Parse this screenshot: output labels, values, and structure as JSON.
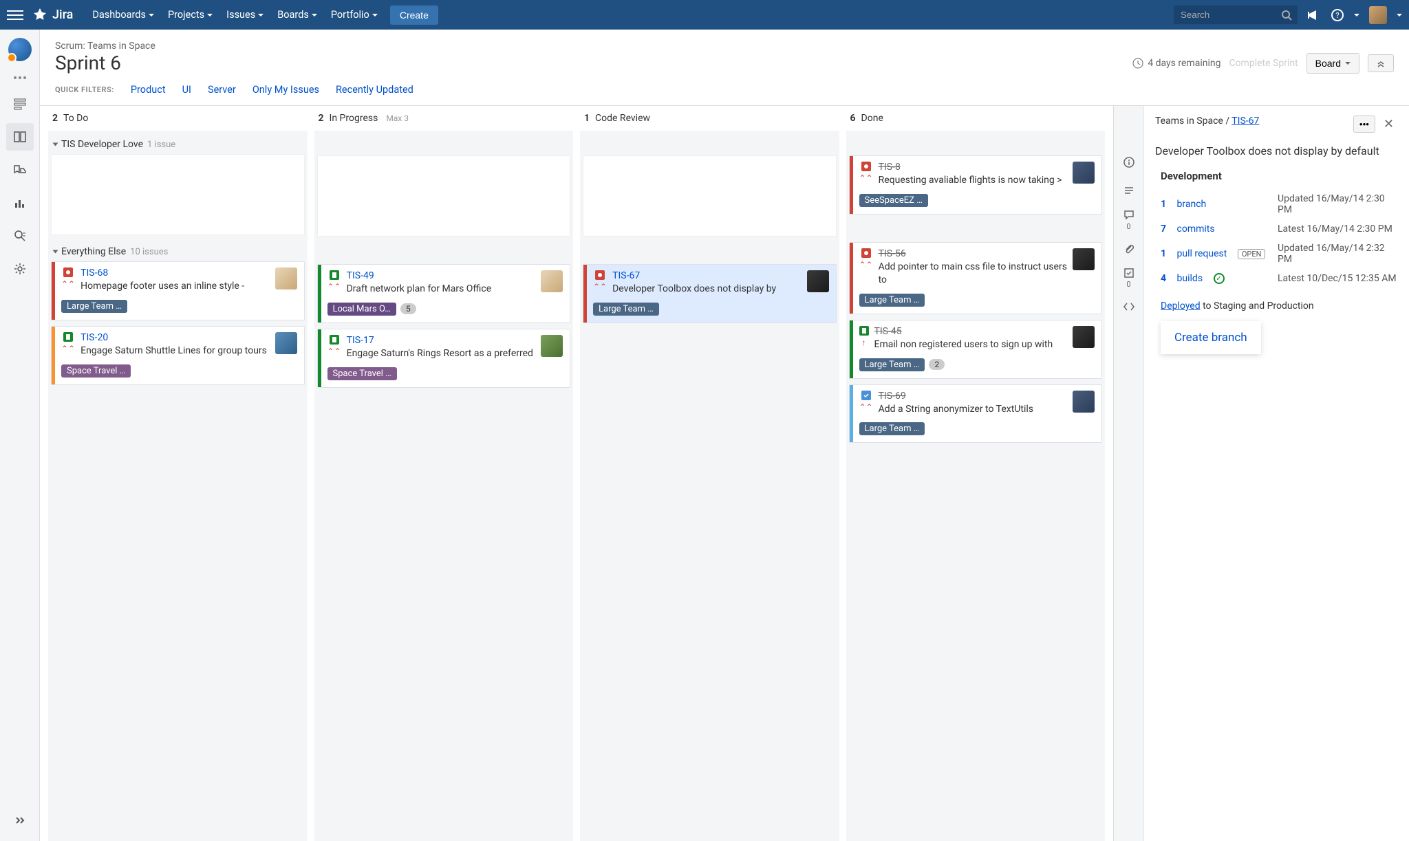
{
  "nav": {
    "product": "Jira",
    "items": [
      "Dashboards",
      "Projects",
      "Issues",
      "Boards",
      "Portfolio"
    ],
    "create": "Create",
    "search_placeholder": "Search"
  },
  "header": {
    "breadcrumb": "Scrum: Teams in Space",
    "title": "Sprint 6",
    "remaining": "4 days remaining",
    "complete": "Complete Sprint",
    "board_btn": "Board"
  },
  "filters": {
    "label": "QUICK FILTERS:",
    "items": [
      "Product",
      "UI",
      "Server",
      "Only My Issues",
      "Recently Updated"
    ]
  },
  "columns": [
    {
      "count": "2",
      "name": "To Do"
    },
    {
      "count": "2",
      "name": "In Progress",
      "max": "Max 3"
    },
    {
      "count": "1",
      "name": "Code Review"
    },
    {
      "count": "6",
      "name": "Done"
    }
  ],
  "lanes": {
    "lane1": {
      "name": "TIS Developer Love",
      "count": "1 issue"
    },
    "lane2": {
      "name": "Everything Else",
      "count": "10 issues"
    }
  },
  "cards": {
    "tis8": {
      "key": "TIS-8",
      "summary": "Requesting avaliable flights is now taking >",
      "epic": "SeeSpaceEZ …"
    },
    "tis68": {
      "key": "TIS-68",
      "summary": "Homepage footer uses an inline style -",
      "epic": "Large Team …"
    },
    "tis49": {
      "key": "TIS-49",
      "summary": "Draft network plan for Mars Office",
      "epic": "Local Mars O…",
      "badge": "5"
    },
    "tis67": {
      "key": "TIS-67",
      "summary": "Developer Toolbox does not display by",
      "epic": "Large Team …"
    },
    "tis56": {
      "key": "TIS-56",
      "summary": "Add pointer to main css file to instruct users to",
      "epic": "Large Team …"
    },
    "tis20": {
      "key": "TIS-20",
      "summary": "Engage Saturn Shuttle Lines for group tours",
      "epic": "Space Travel …"
    },
    "tis17": {
      "key": "TIS-17",
      "summary": "Engage Saturn's Rings Resort as a preferred",
      "epic": "Space Travel …"
    },
    "tis45": {
      "key": "TIS-45",
      "summary": "Email non registered users to sign up with",
      "epic": "Large Team …",
      "badge": "2"
    },
    "tis69": {
      "key": "TIS-69",
      "summary": "Add a String anonymizer to TextUtils",
      "epic": "Large Team …"
    }
  },
  "detail": {
    "project": "Teams in Space",
    "key": "TIS-67",
    "title": "Developer Toolbox does not display by default",
    "dev_heading": "Development",
    "branch": {
      "count": "1",
      "label": "branch",
      "meta": "Updated 16/May/14 2:30 PM"
    },
    "commits": {
      "count": "7",
      "label": "commits",
      "meta": "Latest 16/May/14 2:30 PM"
    },
    "pr": {
      "count": "1",
      "label": "pull request",
      "badge": "OPEN",
      "meta": "Updated 16/May/14 2:32 PM"
    },
    "builds": {
      "count": "4",
      "label": "builds",
      "meta": "Latest 10/Dec/15 12:35 AM"
    },
    "deployed_label": "Deployed",
    "deployed_text": "to Staging and Production",
    "create_branch": "Create branch",
    "comment_count": "0",
    "subtask_count": "0"
  }
}
